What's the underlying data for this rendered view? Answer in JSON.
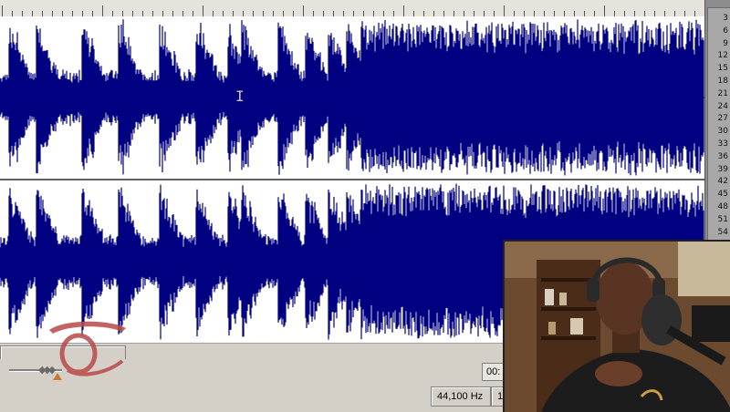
{
  "window": {
    "statusbar": {
      "sample_rate": "44,100 Hz",
      "next_cell": "1"
    },
    "transport": {
      "time_display": "00:"
    }
  },
  "level_meter": {
    "labels": [
      "3",
      "6",
      "9",
      "12",
      "15",
      "18",
      "21",
      "24",
      "27",
      "30",
      "33",
      "36",
      "39",
      "42",
      "45",
      "48",
      "51",
      "54"
    ]
  },
  "waveform": {
    "color": "#000080",
    "channels": [
      "left",
      "right"
    ]
  },
  "icons": {
    "zoom_handle": "diamond-arrows-icon",
    "playhead": "triangle-marker-icon",
    "cursor": "text-cursor-icon"
  },
  "colors": {
    "background": "#ffffff",
    "waveform": "#000080",
    "chrome": "#d4d0c8",
    "meter": "#8c8c8c"
  }
}
